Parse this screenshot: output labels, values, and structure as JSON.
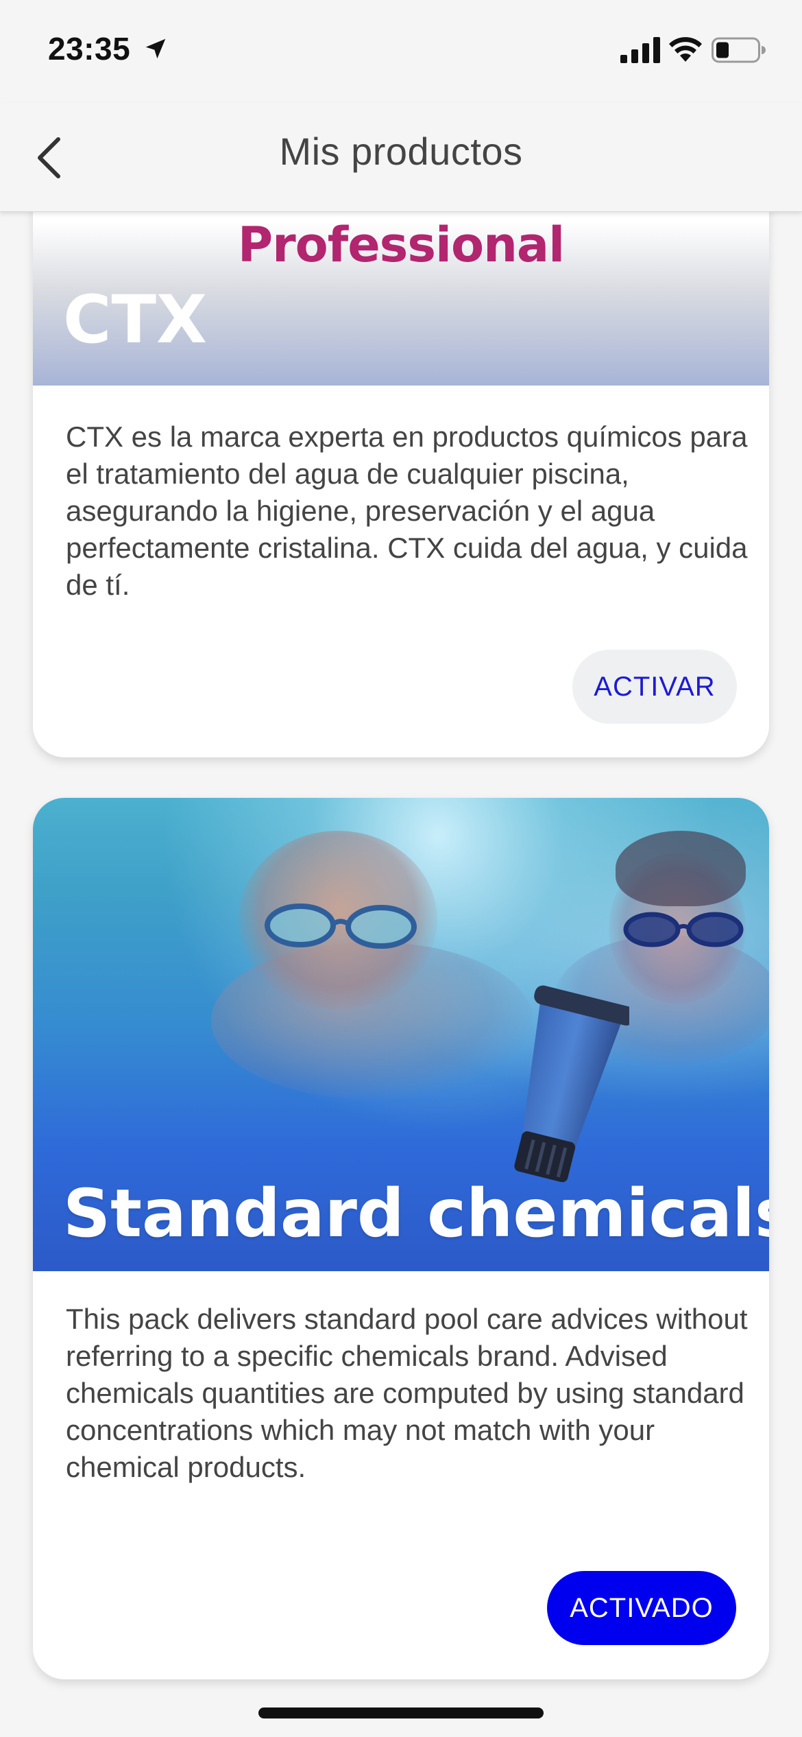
{
  "status_bar": {
    "time": "23:35",
    "icons": [
      "location-arrow-icon",
      "cellular-signal-icon",
      "wifi-icon",
      "battery-icon"
    ]
  },
  "nav": {
    "title": "Mis productos",
    "back_icon": "chevron-left-icon"
  },
  "cards": [
    {
      "logo_text": "Professional",
      "title": "CTX",
      "description": "CTX es la marca experta en productos químicos para el tratamiento del agua de cualquier piscina, asegurando la higiene, preservación y el agua perfectamente cristalina. CTX cuida del agua, y cuida de tí.",
      "button_label": "ACTIVAR",
      "active": false
    },
    {
      "title": "Standard chemicals",
      "description": "This pack delivers standard pool care advices without referring to a specific chemicals brand. Advised chemicals quantities are computed by using standard concentrations which may not match with your chemical products.",
      "button_label": "ACTIVADO",
      "active": true
    }
  ],
  "colors": {
    "background": "#f5f5f5",
    "card": "#ffffff",
    "accent": "#0000ee",
    "inactive_button_bg": "#eff0f1",
    "inactive_button_text": "#1b1bd4",
    "ctx_logo": "#b2256f"
  }
}
